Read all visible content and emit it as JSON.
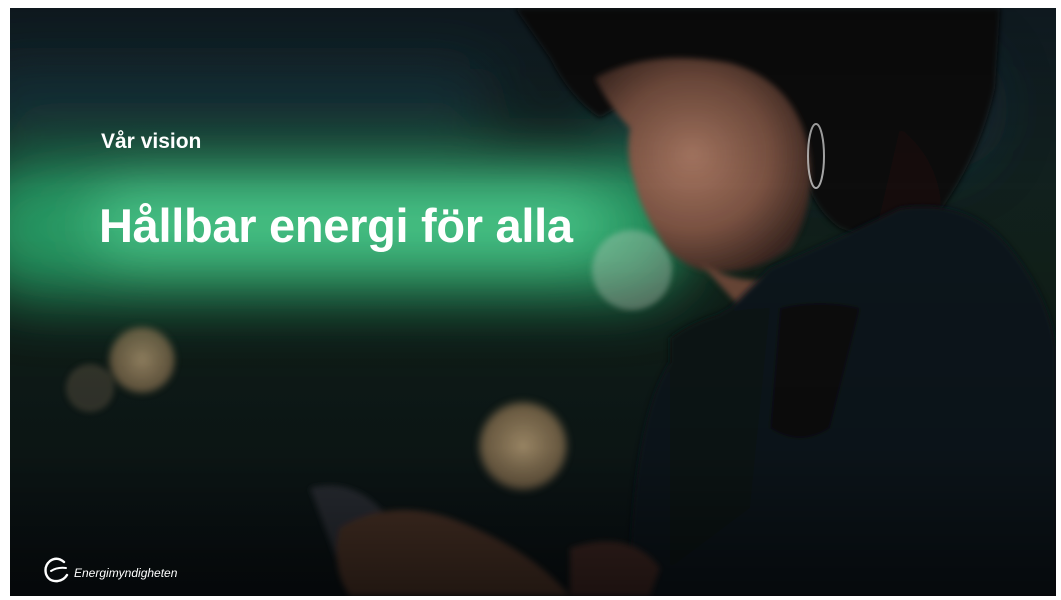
{
  "slide": {
    "eyebrow": "Vår vision",
    "headline": "Hållbar energi för alla"
  },
  "brand": {
    "name": "Energimyndigheten",
    "logo_icon": "energimyndigheten-logo-icon"
  },
  "colors": {
    "text": "#ffffff",
    "accent_glow": "#35d68a",
    "background": "#0d1418"
  }
}
